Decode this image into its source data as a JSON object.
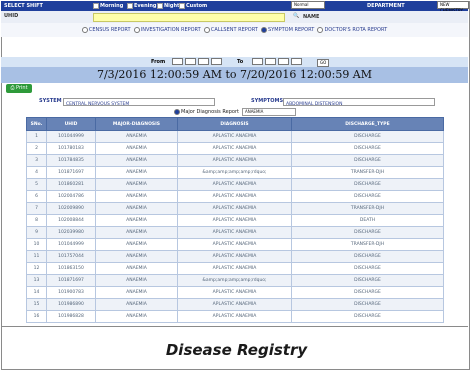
{
  "topbar": {
    "select_shift": "SELECT SHIFT",
    "shifts": [
      "Morning",
      "Evening",
      "Night",
      "Custom"
    ],
    "shift_select": "Normal",
    "department_label": "DEPARTMENT",
    "department_value": "NEW CHEMISTRY"
  },
  "row2": {
    "uhid_label": "UHID",
    "name_label": "NAME"
  },
  "reports": {
    "items": [
      {
        "label": "CENSUS REPORT",
        "selected": false
      },
      {
        "label": "INVESTIGATION REPORT",
        "selected": false
      },
      {
        "label": "CALLSENT REPORT",
        "selected": false
      },
      {
        "label": "SYMPTOM REPORT",
        "selected": true
      },
      {
        "label": "DOCTOR'S ROTA REPORT",
        "selected": false
      }
    ]
  },
  "datebar": {
    "from_label": "From",
    "to_label": "To",
    "go_label": "GO"
  },
  "range_text": "7/3/2016 12:00:59 AM to 7/20/2016 12:00:59 AM",
  "print_label": "Print",
  "filters": {
    "system_label": "SYSTEM",
    "system_value": "CENTRAL NERVOUS SYSTEM",
    "symptoms_label": "SYMPTOMS",
    "symptoms_value": "ABDOMINAL DISTENSION"
  },
  "table": {
    "title": "Major Diagnosis Report",
    "indicator": "ANAEMIA",
    "headers": [
      "SNo.",
      "UHID",
      "MAJOR-DIAGNOSIS",
      "DIAGNOSIS",
      "DISCHARGE_TYPE"
    ],
    "rows": [
      [
        "1",
        "101044999",
        "ANAEMIA",
        "APLASTIC ANAEMIA",
        "DISCHARGE"
      ],
      [
        "2",
        "101780183",
        "ANAEMIA",
        "APLASTIC ANAEMIA",
        "DISCHARGE"
      ],
      [
        "3",
        "101784835",
        "ANAEMIA",
        "APLASTIC ANAEMIA",
        "DISCHARGE"
      ],
      [
        "4",
        "101871697",
        "ANAEMIA",
        "&amp;amp;amp;amp;rdquo;",
        "TRANSFER-DJH"
      ],
      [
        "5",
        "101860281",
        "ANAEMIA",
        "APLASTIC ANAEMIA",
        "DISCHARGE"
      ],
      [
        "6",
        "102004786",
        "ANAEMIA",
        "APLASTIC ANAEMIA",
        "DISCHARGE"
      ],
      [
        "7",
        "102009890",
        "ANAEMIA",
        "APLASTIC ANAEMIA",
        "TRANSFER-DJH"
      ],
      [
        "8",
        "102008844",
        "ANAEMIA",
        "APLASTIC ANAEMIA",
        "DEATH"
      ],
      [
        "9",
        "102039980",
        "ANAEMIA",
        "APLASTIC ANAEMIA",
        "DISCHARGE"
      ],
      [
        "10",
        "101044999",
        "ANAEMIA",
        "APLASTIC ANAEMIA",
        "TRANSFER-DJH"
      ],
      [
        "11",
        "101757044",
        "ANAEMIA",
        "APLASTIC ANAEMIA",
        "DISCHARGE"
      ],
      [
        "12",
        "101863150",
        "ANAEMIA",
        "APLASTIC ANAEMIA",
        "DISCHARGE"
      ],
      [
        "13",
        "101871697",
        "ANAEMIA",
        "&amp;amp;amp;amp;rdquo;",
        "DISCHARGE"
      ],
      [
        "14",
        "101900783",
        "ANAEMIA",
        "APLASTIC ANAEMIA",
        "DISCHARGE"
      ],
      [
        "15",
        "101986890",
        "ANAEMIA",
        "APLASTIC ANAEMIA",
        "DISCHARGE"
      ],
      [
        "16",
        "101986828",
        "ANAEMIA",
        "APLASTIC ANAEMIA",
        "DISCHARGE"
      ]
    ]
  },
  "caption": "Disease Registry",
  "colors": {
    "topbar": "#1f3f9c",
    "header": "#6783b6",
    "range": "#a8c0e4",
    "print": "#2e9a3a"
  }
}
